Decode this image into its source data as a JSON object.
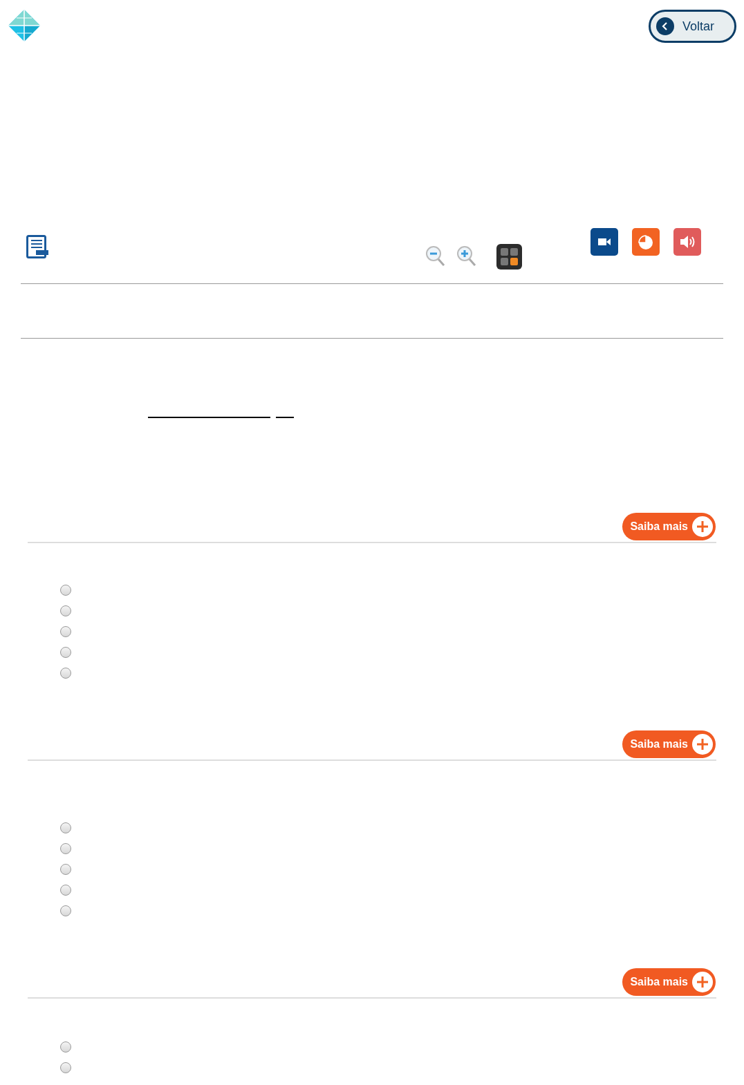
{
  "header": {
    "back_button": "Voltar"
  },
  "questions": [
    {
      "more_button": "Saiba mais",
      "options": [
        {
          "selected": false
        },
        {
          "selected": false
        },
        {
          "selected": false
        },
        {
          "selected": false
        },
        {
          "selected": false
        }
      ]
    },
    {
      "more_button": "Saiba mais",
      "options": [
        {
          "selected": false
        },
        {
          "selected": false
        },
        {
          "selected": false
        },
        {
          "selected": false
        },
        {
          "selected": false
        }
      ]
    },
    {
      "more_button": "Saiba mais",
      "options": [
        {
          "selected": false
        },
        {
          "selected": false
        }
      ]
    }
  ]
}
